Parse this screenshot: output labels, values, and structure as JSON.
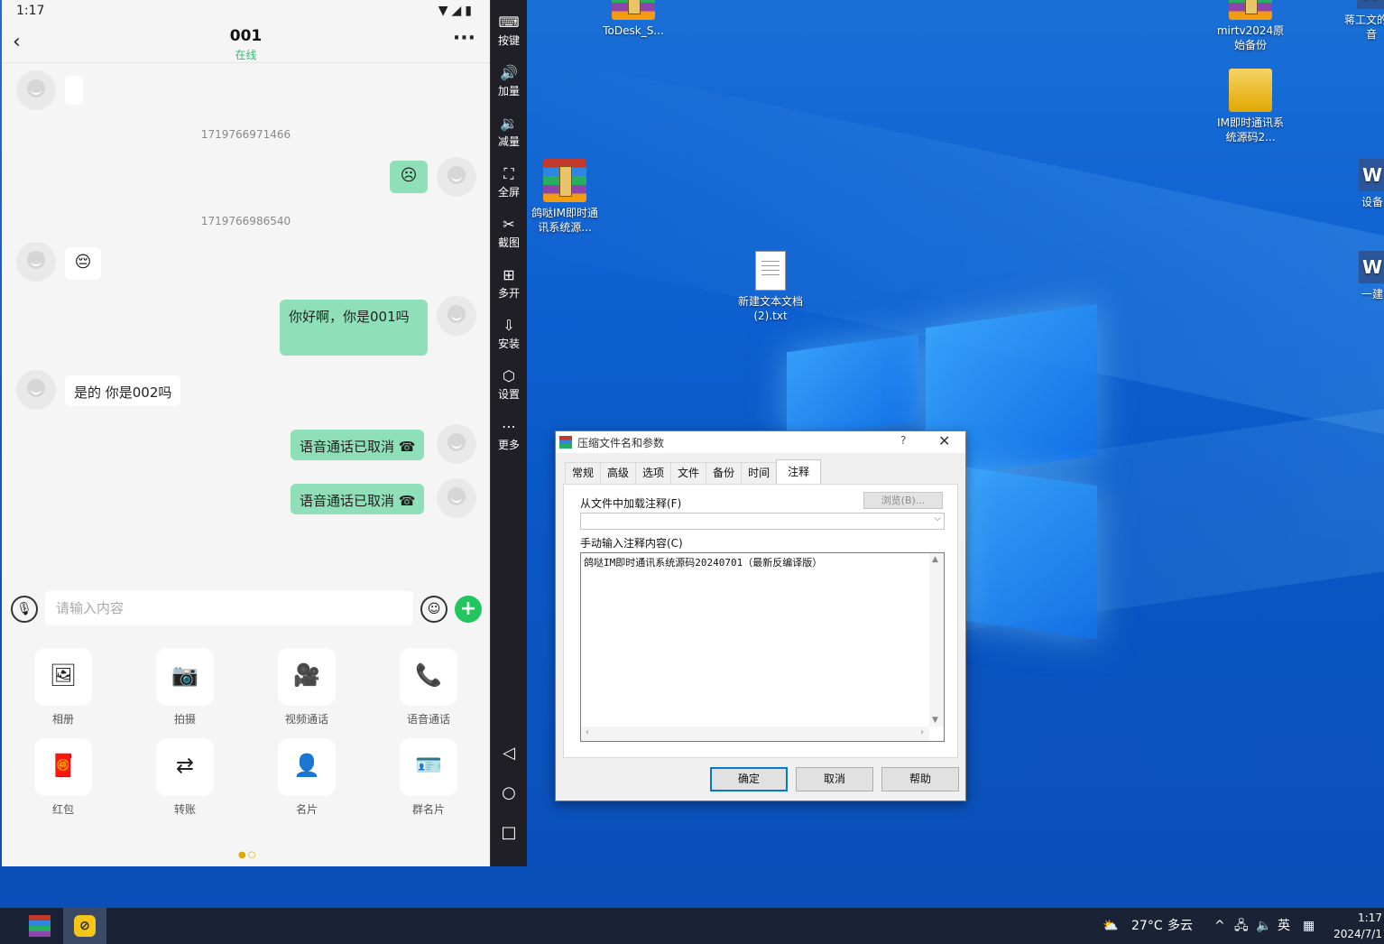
{
  "phone": {
    "status": {
      "time": "1:17",
      "icons": "▼◢▮"
    },
    "header": {
      "title": "001",
      "status": "在线"
    },
    "messages": [
      {
        "type": "in",
        "text": ""
      },
      {
        "type": "time",
        "text": "1719766971466"
      },
      {
        "type": "out",
        "text": "☹"
      },
      {
        "type": "time",
        "text": "1719766986540"
      },
      {
        "type": "in",
        "text": "😔"
      },
      {
        "type": "out",
        "text": "你好啊，你是001吗"
      },
      {
        "type": "in",
        "text": "是的 你是002吗"
      },
      {
        "type": "out",
        "text": "语音通话已取消 ☎"
      },
      {
        "type": "out",
        "text": "语音通话已取消 ☎"
      }
    ],
    "input": {
      "placeholder": "请输入内容"
    },
    "actions": [
      "相册",
      "拍摄",
      "视频通话",
      "语音通话",
      "红包",
      "转账",
      "名片",
      "群名片"
    ],
    "action_icons": [
      "image-icon",
      "camera-icon",
      "video-icon",
      "phone-icon",
      "red-packet-icon",
      "transfer-icon",
      "contact-card-icon",
      "group-card-icon"
    ]
  },
  "toolbar": {
    "items": [
      "按键",
      "加量",
      "减量",
      "全屏",
      "截图",
      "多开",
      "安装",
      "设置",
      "更多"
    ]
  },
  "desktop": {
    "icons": [
      "ToDesk_S...",
      "mirtv2024原始备份",
      "蒋工文的抖音",
      "IM即时通讯系统源码2...",
      "鸽哒IM即时通讯系统源...",
      "新建文本文档(2).txt",
      "设备",
      "一建"
    ]
  },
  "dialog": {
    "title": "压缩文件名和参数",
    "help": "?",
    "tabs": [
      "常规",
      "高级",
      "选项",
      "文件",
      "备份",
      "时间",
      "注释"
    ],
    "active_tab": "注释",
    "load_label": "从文件中加载注释(F)",
    "browse_label": "浏览(B)...",
    "manual_label": "手动输入注释内容(C)",
    "comment_text": "鸽哒IM即时通讯系统源码20240701（最新反编译版）",
    "buttons": {
      "ok": "确定",
      "cancel": "取消",
      "help": "帮助"
    }
  },
  "taskbar": {
    "weather_temp": "27°C",
    "weather_desc": "多云",
    "ime": "英",
    "clock_time": "1:17",
    "clock_date": "2024/7/1"
  }
}
